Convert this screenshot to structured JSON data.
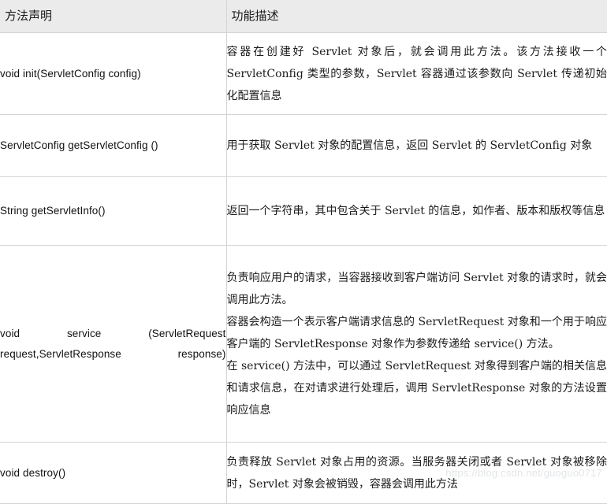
{
  "table": {
    "headers": [
      "方法声明",
      "功能描述"
    ],
    "rows": [
      {
        "method": "void init(ServletConfig config)",
        "method_justified": false,
        "description_paragraphs": [
          "容器在创建好 Servlet 对象后，就会调用此方法。该方法接收一个 ServletConfig 类型的参数，Servlet 容器通过该参数向 Servlet 传递初始化配置信息"
        ]
      },
      {
        "method": "ServletConfig getServletConfig ()",
        "method_justified": false,
        "description_paragraphs": [
          "用于获取 Servlet 对象的配置信息，返回 Servlet 的 ServletConfig 对象"
        ]
      },
      {
        "method": "String getServletInfo()",
        "method_justified": false,
        "description_paragraphs": [
          "返回一个字符串，其中包含关于 Servlet 的信息，如作者、版本和版权等信息"
        ]
      },
      {
        "method": "void service (ServletRequest request,ServletResponse response)",
        "method_justified": true,
        "method_lines": [
          "void service (ServletRequest",
          "request,ServletResponse response)"
        ],
        "description_paragraphs": [
          "负责响应用户的请求，当容器接收到客户端访问 Servlet 对象的请求时，就会调用此方法。",
          "容器会构造一个表示客户端请求信息的 ServletRequest 对象和一个用于响应客户端的 ServletResponse 对象作为参数传递给 service() 方法。",
          "在 service() 方法中，可以通过 ServletRequest 对象得到客户端的相关信息和请求信息，在对请求进行处理后，调用 ServletResponse 对象的方法设置响应信息"
        ]
      },
      {
        "method": "void destroy()",
        "method_justified": false,
        "description_paragraphs": [
          "负责释放 Servlet 对象占用的资源。当服务器关闭或者 Servlet 对象被移除时，Servlet 对象会被销毁，容器会调用此方法"
        ]
      }
    ]
  },
  "watermark": {
    "text": "https://blog.csdn.net/guoguo0717"
  },
  "colors": {
    "header_bg": "#ebebeb",
    "border": "#d4d4d4",
    "text": "#1b1b1b",
    "watermark": "#e3e6e8"
  }
}
